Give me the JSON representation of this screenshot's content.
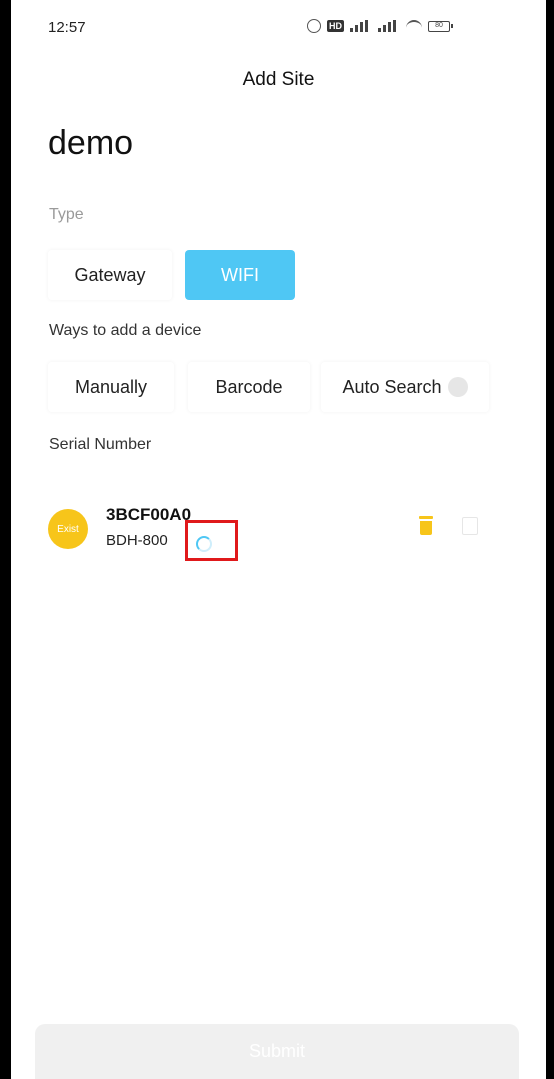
{
  "status_bar": {
    "time": "12:57",
    "hd_badge": "HD",
    "battery_level": "80"
  },
  "header": {
    "title": "Add Site"
  },
  "site": {
    "name": "demo"
  },
  "type_section": {
    "label": "Type",
    "options": [
      "Gateway",
      "WIFI"
    ],
    "selected": "WIFI"
  },
  "ways_section": {
    "label": "Ways to add a device",
    "options": [
      "Manually",
      "Barcode",
      "Auto Search"
    ]
  },
  "serial_section": {
    "label": "Serial Number"
  },
  "device": {
    "badge": "Exist",
    "serial": "3BCF00A0",
    "model": "BDH-800"
  },
  "footer": {
    "submit_label": "Submit"
  },
  "colors": {
    "accent": "#4fc7f4",
    "badge": "#f7c51a",
    "highlight": "#e0191b"
  }
}
